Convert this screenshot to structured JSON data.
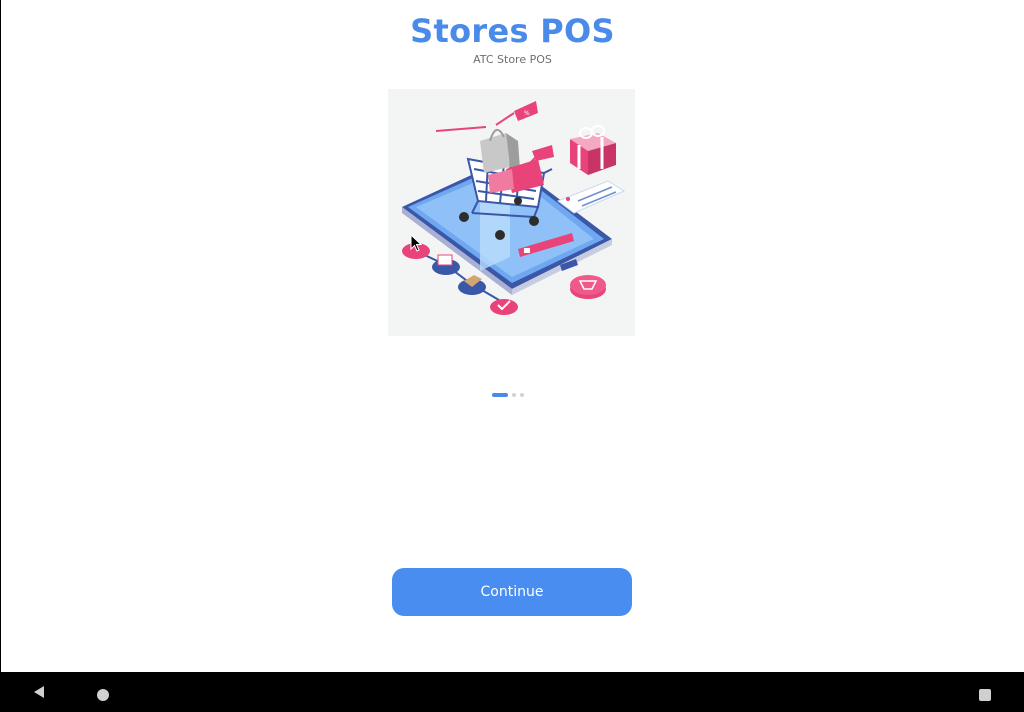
{
  "app": {
    "title": "Stores POS",
    "subtitle": "ATC Store POS"
  },
  "onboarding": {
    "page_count": 3,
    "active_page": 1,
    "continue_label": "Continue"
  },
  "illustration": {
    "icon": "shopping-cart-on-phone-illustration",
    "tag_text": "%"
  },
  "colors": {
    "accent": "#4a8ae8",
    "button": "#4a8df0",
    "pink": "#e8447a",
    "navy": "#2e4a9a"
  }
}
